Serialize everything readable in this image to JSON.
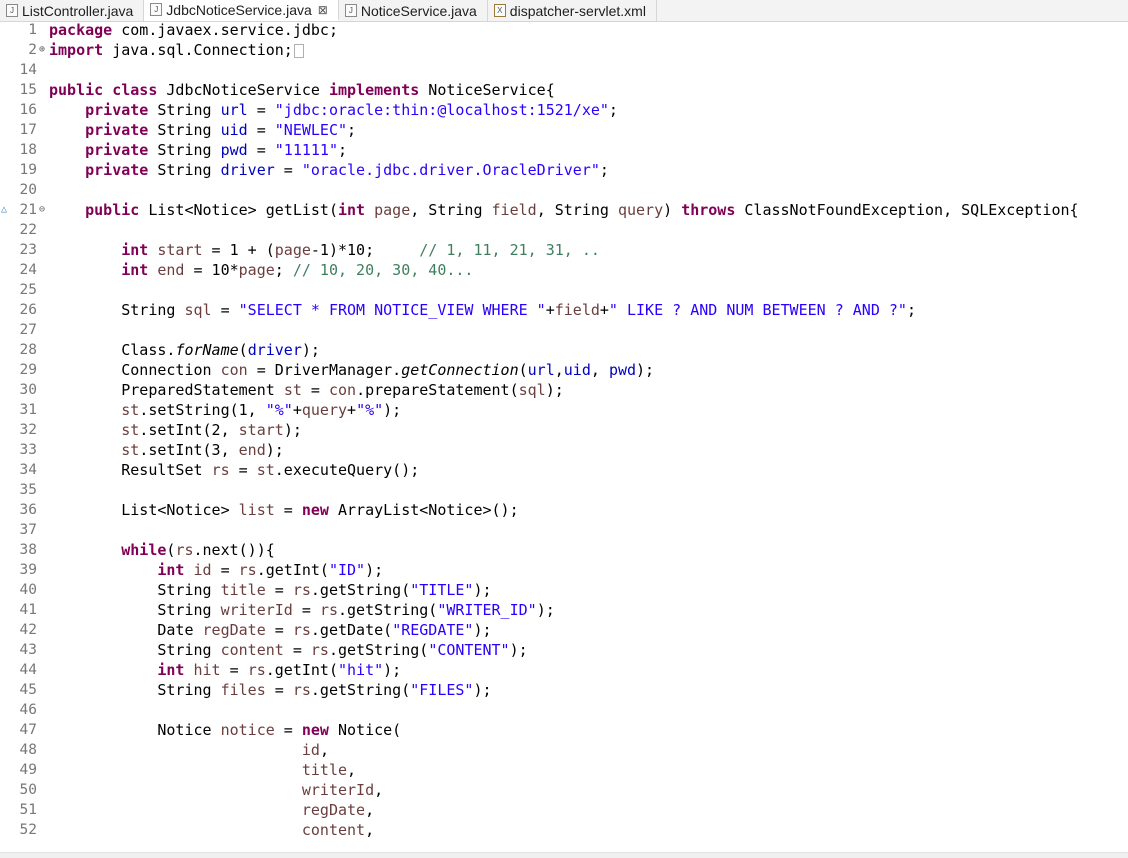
{
  "tabs": [
    {
      "label": "ListController.java",
      "icon": "java-file-icon",
      "active": false
    },
    {
      "label": "JdbcNoticeService.java",
      "icon": "java-file-icon",
      "active": true,
      "close": "⊠"
    },
    {
      "label": "NoticeService.java",
      "icon": "java-file-icon",
      "active": false
    },
    {
      "label": "dispatcher-servlet.xml",
      "icon": "xml-file-icon",
      "active": false
    }
  ],
  "colors": {
    "keyword": "#7f0055",
    "string": "#2a00ff",
    "field": "#0000c0",
    "local_variable": "#6a3e3e",
    "comment": "#3f7f5f",
    "line_number": "#787878"
  },
  "editor": {
    "lines": [
      {
        "n": "1",
        "t": [
          [
            "kw",
            "package"
          ],
          [
            "p",
            " com.javaex.service.jdbc;"
          ]
        ]
      },
      {
        "n": "2",
        "mark": "⊕",
        "t": [
          [
            "kw",
            "import"
          ],
          [
            "p",
            " java.sql.Connection;"
          ]
        ],
        "fold": true
      },
      {
        "n": "14",
        "t": []
      },
      {
        "n": "15",
        "t": [
          [
            "kw",
            "public class"
          ],
          [
            "p",
            " JdbcNoticeService "
          ],
          [
            "kw",
            "implements"
          ],
          [
            "p",
            " NoticeService{"
          ]
        ]
      },
      {
        "n": "16",
        "t": [
          [
            "p",
            "    "
          ],
          [
            "kw",
            "private"
          ],
          [
            "p",
            " String "
          ],
          [
            "fld",
            "url"
          ],
          [
            "p",
            " = "
          ],
          [
            "str",
            "\"jdbc:oracle:thin:@localhost:1521/xe\""
          ],
          [
            "p",
            ";"
          ]
        ]
      },
      {
        "n": "17",
        "t": [
          [
            "p",
            "    "
          ],
          [
            "kw",
            "private"
          ],
          [
            "p",
            " String "
          ],
          [
            "fld",
            "uid"
          ],
          [
            "p",
            " = "
          ],
          [
            "str",
            "\"NEWLEC\""
          ],
          [
            "p",
            ";"
          ]
        ]
      },
      {
        "n": "18",
        "t": [
          [
            "p",
            "    "
          ],
          [
            "kw",
            "private"
          ],
          [
            "p",
            " String "
          ],
          [
            "fld",
            "pwd"
          ],
          [
            "p",
            " = "
          ],
          [
            "str",
            "\"11111\""
          ],
          [
            "p",
            ";"
          ]
        ]
      },
      {
        "n": "19",
        "t": [
          [
            "p",
            "    "
          ],
          [
            "kw",
            "private"
          ],
          [
            "p",
            " String "
          ],
          [
            "fld",
            "driver"
          ],
          [
            "p",
            " = "
          ],
          [
            "str",
            "\"oracle.jdbc.driver.OracleDriver\""
          ],
          [
            "p",
            ";"
          ]
        ]
      },
      {
        "n": "20",
        "t": []
      },
      {
        "n": "21",
        "mark": "⊖",
        "override": "△",
        "t": [
          [
            "p",
            "    "
          ],
          [
            "kw",
            "public"
          ],
          [
            "p",
            " List<Notice> getList("
          ],
          [
            "kw",
            "int"
          ],
          [
            "p",
            " "
          ],
          [
            "var",
            "page"
          ],
          [
            "p",
            ", String "
          ],
          [
            "var",
            "field"
          ],
          [
            "p",
            ", String "
          ],
          [
            "var",
            "query"
          ],
          [
            "p",
            ") "
          ],
          [
            "kw",
            "throws"
          ],
          [
            "p",
            " ClassNotFoundException, SQLException{"
          ]
        ]
      },
      {
        "n": "22",
        "t": []
      },
      {
        "n": "23",
        "t": [
          [
            "p",
            "        "
          ],
          [
            "kw",
            "int"
          ],
          [
            "p",
            " "
          ],
          [
            "var",
            "start"
          ],
          [
            "p",
            " = 1 + ("
          ],
          [
            "var",
            "page"
          ],
          [
            "p",
            "-1)*10;     "
          ],
          [
            "cmt",
            "// 1, 11, 21, 31, .."
          ]
        ]
      },
      {
        "n": "24",
        "t": [
          [
            "p",
            "        "
          ],
          [
            "kw",
            "int"
          ],
          [
            "p",
            " "
          ],
          [
            "var",
            "end"
          ],
          [
            "p",
            " = 10*"
          ],
          [
            "var",
            "page"
          ],
          [
            "p",
            "; "
          ],
          [
            "cmt",
            "// 10, 20, 30, 40..."
          ]
        ]
      },
      {
        "n": "25",
        "t": []
      },
      {
        "n": "26",
        "t": [
          [
            "p",
            "        String "
          ],
          [
            "var",
            "sql"
          ],
          [
            "p",
            " = "
          ],
          [
            "str",
            "\"SELECT * FROM NOTICE_VIEW WHERE \""
          ],
          [
            "p",
            "+"
          ],
          [
            "var",
            "field"
          ],
          [
            "p",
            "+"
          ],
          [
            "str",
            "\" LIKE ? AND NUM BETWEEN ? AND ?\""
          ],
          [
            "p",
            ";"
          ]
        ]
      },
      {
        "n": "27",
        "t": []
      },
      {
        "n": "28",
        "t": [
          [
            "p",
            "        Class."
          ],
          [
            "ital",
            "forName"
          ],
          [
            "p",
            "("
          ],
          [
            "fld",
            "driver"
          ],
          [
            "p",
            ");"
          ]
        ]
      },
      {
        "n": "29",
        "t": [
          [
            "p",
            "        Connection "
          ],
          [
            "var",
            "con"
          ],
          [
            "p",
            " = DriverManager."
          ],
          [
            "ital",
            "getConnection"
          ],
          [
            "p",
            "("
          ],
          [
            "fld",
            "url"
          ],
          [
            "p",
            ","
          ],
          [
            "fld",
            "uid"
          ],
          [
            "p",
            ", "
          ],
          [
            "fld",
            "pwd"
          ],
          [
            "p",
            ");"
          ]
        ]
      },
      {
        "n": "30",
        "t": [
          [
            "p",
            "        PreparedStatement "
          ],
          [
            "var",
            "st"
          ],
          [
            "p",
            " = "
          ],
          [
            "var",
            "con"
          ],
          [
            "p",
            ".prepareStatement("
          ],
          [
            "var",
            "sql"
          ],
          [
            "p",
            ");"
          ]
        ]
      },
      {
        "n": "31",
        "t": [
          [
            "p",
            "        "
          ],
          [
            "var",
            "st"
          ],
          [
            "p",
            ".setString(1, "
          ],
          [
            "str",
            "\"%\""
          ],
          [
            "p",
            "+"
          ],
          [
            "var",
            "query"
          ],
          [
            "p",
            "+"
          ],
          [
            "str",
            "\"%\""
          ],
          [
            "p",
            ");"
          ]
        ]
      },
      {
        "n": "32",
        "t": [
          [
            "p",
            "        "
          ],
          [
            "var",
            "st"
          ],
          [
            "p",
            ".setInt(2, "
          ],
          [
            "var",
            "start"
          ],
          [
            "p",
            ");"
          ]
        ]
      },
      {
        "n": "33",
        "t": [
          [
            "p",
            "        "
          ],
          [
            "var",
            "st"
          ],
          [
            "p",
            ".setInt(3, "
          ],
          [
            "var",
            "end"
          ],
          [
            "p",
            ");"
          ]
        ]
      },
      {
        "n": "34",
        "t": [
          [
            "p",
            "        ResultSet "
          ],
          [
            "var",
            "rs"
          ],
          [
            "p",
            " = "
          ],
          [
            "var",
            "st"
          ],
          [
            "p",
            ".executeQuery();"
          ]
        ]
      },
      {
        "n": "35",
        "t": []
      },
      {
        "n": "36",
        "t": [
          [
            "p",
            "        List<Notice> "
          ],
          [
            "var",
            "list"
          ],
          [
            "p",
            " = "
          ],
          [
            "kw",
            "new"
          ],
          [
            "p",
            " ArrayList<Notice>();"
          ]
        ]
      },
      {
        "n": "37",
        "t": []
      },
      {
        "n": "38",
        "t": [
          [
            "p",
            "        "
          ],
          [
            "kw",
            "while"
          ],
          [
            "p",
            "("
          ],
          [
            "var",
            "rs"
          ],
          [
            "p",
            ".next()){"
          ]
        ]
      },
      {
        "n": "39",
        "t": [
          [
            "p",
            "            "
          ],
          [
            "kw",
            "int"
          ],
          [
            "p",
            " "
          ],
          [
            "var",
            "id"
          ],
          [
            "p",
            " = "
          ],
          [
            "var",
            "rs"
          ],
          [
            "p",
            ".getInt("
          ],
          [
            "str",
            "\"ID\""
          ],
          [
            "p",
            ");"
          ]
        ]
      },
      {
        "n": "40",
        "t": [
          [
            "p",
            "            String "
          ],
          [
            "var",
            "title"
          ],
          [
            "p",
            " = "
          ],
          [
            "var",
            "rs"
          ],
          [
            "p",
            ".getString("
          ],
          [
            "str",
            "\"TITLE\""
          ],
          [
            "p",
            ");"
          ]
        ]
      },
      {
        "n": "41",
        "t": [
          [
            "p",
            "            String "
          ],
          [
            "var",
            "writerId"
          ],
          [
            "p",
            " = "
          ],
          [
            "var",
            "rs"
          ],
          [
            "p",
            ".getString("
          ],
          [
            "str",
            "\"WRITER_ID\""
          ],
          [
            "p",
            ");"
          ]
        ]
      },
      {
        "n": "42",
        "t": [
          [
            "p",
            "            Date "
          ],
          [
            "var",
            "regDate"
          ],
          [
            "p",
            " = "
          ],
          [
            "var",
            "rs"
          ],
          [
            "p",
            ".getDate("
          ],
          [
            "str",
            "\"REGDATE\""
          ],
          [
            "p",
            ");"
          ]
        ]
      },
      {
        "n": "43",
        "t": [
          [
            "p",
            "            String "
          ],
          [
            "var",
            "content"
          ],
          [
            "p",
            " = "
          ],
          [
            "var",
            "rs"
          ],
          [
            "p",
            ".getString("
          ],
          [
            "str",
            "\"CONTENT\""
          ],
          [
            "p",
            ");"
          ]
        ]
      },
      {
        "n": "44",
        "t": [
          [
            "p",
            "            "
          ],
          [
            "kw",
            "int"
          ],
          [
            "p",
            " "
          ],
          [
            "var",
            "hit"
          ],
          [
            "p",
            " = "
          ],
          [
            "var",
            "rs"
          ],
          [
            "p",
            ".getInt("
          ],
          [
            "str",
            "\"hit\""
          ],
          [
            "p",
            ");"
          ]
        ]
      },
      {
        "n": "45",
        "t": [
          [
            "p",
            "            String "
          ],
          [
            "var",
            "files"
          ],
          [
            "p",
            " = "
          ],
          [
            "var",
            "rs"
          ],
          [
            "p",
            ".getString("
          ],
          [
            "str",
            "\"FILES\""
          ],
          [
            "p",
            ");"
          ]
        ]
      },
      {
        "n": "46",
        "t": []
      },
      {
        "n": "47",
        "t": [
          [
            "p",
            "            Notice "
          ],
          [
            "var",
            "notice"
          ],
          [
            "p",
            " = "
          ],
          [
            "kw",
            "new"
          ],
          [
            "p",
            " Notice("
          ]
        ]
      },
      {
        "n": "48",
        "t": [
          [
            "p",
            "                            "
          ],
          [
            "var",
            "id"
          ],
          [
            "p",
            ","
          ]
        ]
      },
      {
        "n": "49",
        "t": [
          [
            "p",
            "                            "
          ],
          [
            "var",
            "title"
          ],
          [
            "p",
            ","
          ]
        ]
      },
      {
        "n": "50",
        "t": [
          [
            "p",
            "                            "
          ],
          [
            "var",
            "writerId"
          ],
          [
            "p",
            ","
          ]
        ]
      },
      {
        "n": "51",
        "t": [
          [
            "p",
            "                            "
          ],
          [
            "var",
            "regDate"
          ],
          [
            "p",
            ","
          ]
        ]
      },
      {
        "n": "52",
        "t": [
          [
            "p",
            "                            "
          ],
          [
            "var",
            "content"
          ],
          [
            "p",
            ","
          ]
        ]
      }
    ]
  }
}
